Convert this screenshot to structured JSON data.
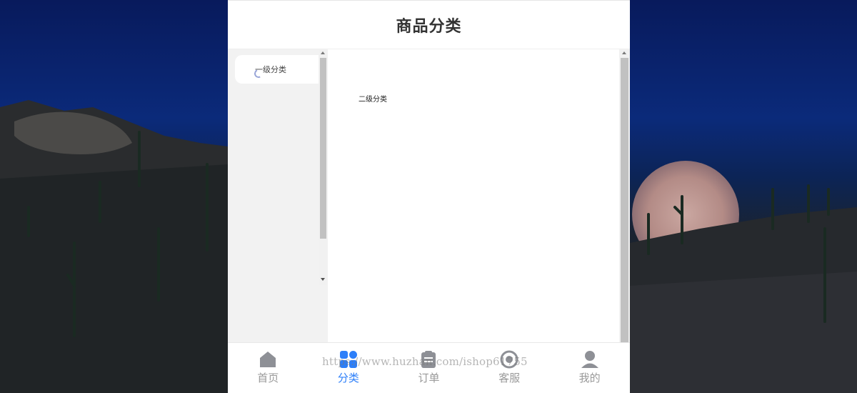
{
  "header": {
    "title": "商品分类"
  },
  "categories": {
    "level1": [
      {
        "label": "一级分类"
      }
    ],
    "level2_title": "二级分类"
  },
  "tabbar": {
    "items": [
      {
        "label": "首页",
        "icon": "home-icon",
        "active": false
      },
      {
        "label": "分类",
        "icon": "category-icon",
        "active": true
      },
      {
        "label": "订单",
        "icon": "order-icon",
        "active": false
      },
      {
        "label": "客服",
        "icon": "customer-service-icon",
        "active": false
      },
      {
        "label": "我的",
        "icon": "profile-icon",
        "active": false
      }
    ]
  },
  "watermark": "https://www.huzhan.com/ishop61755",
  "colors": {
    "accent": "#2d7ff9",
    "inactive": "#999999",
    "left_pane_bg": "#f2f2f2"
  }
}
